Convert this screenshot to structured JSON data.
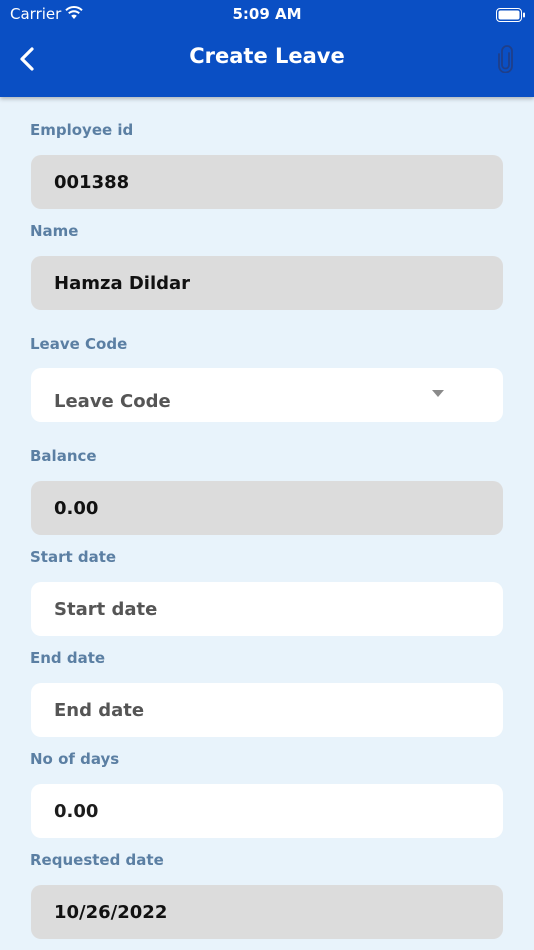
{
  "status_bar": {
    "carrier": "Carrier",
    "time": "5:09 AM"
  },
  "header": {
    "title": "Create Leave",
    "back_icon": "chevron-left-icon",
    "attach_icon": "paperclip-icon"
  },
  "colors": {
    "header_bg": "#0a4fc4",
    "page_bg": "#e8f3fb",
    "label": "#5b7fa3",
    "readonly_bg": "#dcdcdc"
  },
  "form": {
    "employee_id": {
      "label": "Employee id",
      "value": "001388"
    },
    "name": {
      "label": "Name",
      "value": "Hamza Dildar"
    },
    "leave_code": {
      "label": "Leave Code",
      "placeholder": "Leave Code"
    },
    "balance": {
      "label": "Balance",
      "value": "0.00"
    },
    "start_date": {
      "label": "Start date",
      "placeholder": "Start date"
    },
    "end_date": {
      "label": "End date",
      "placeholder": "End date"
    },
    "no_of_days": {
      "label": "No of days",
      "value": "0.00"
    },
    "requested_date": {
      "label": "Requested date",
      "value": "10/26/2022"
    }
  }
}
